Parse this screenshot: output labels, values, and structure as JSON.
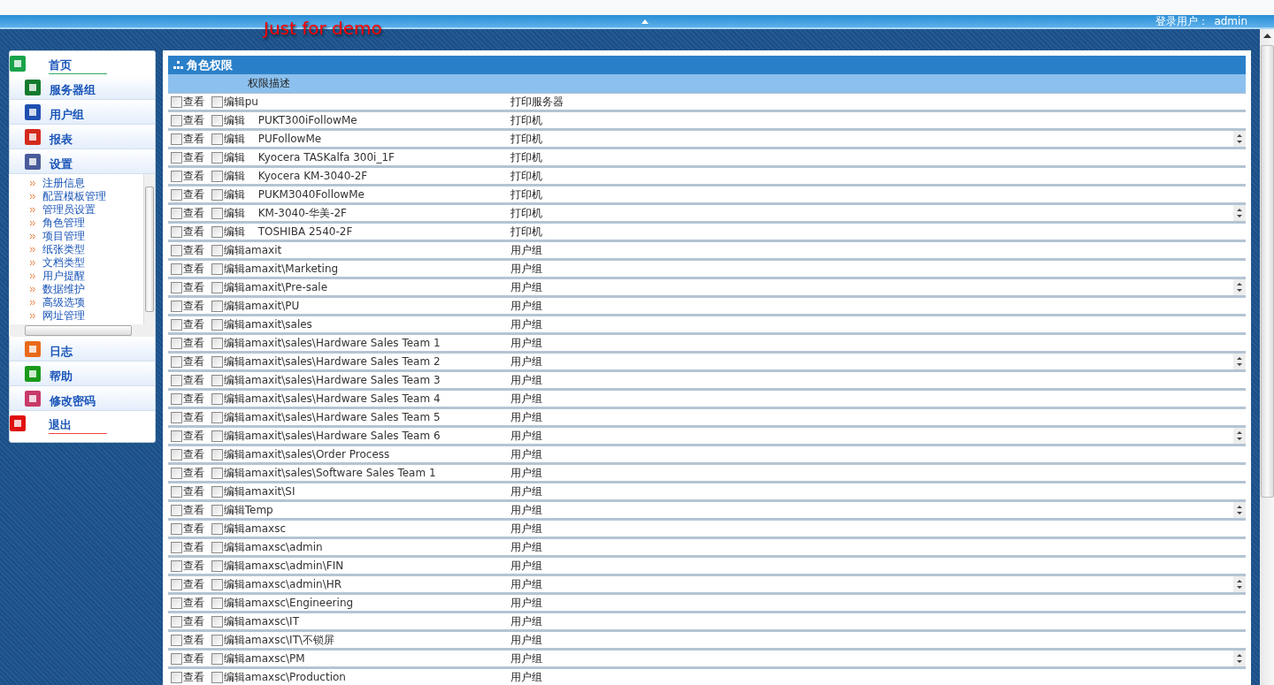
{
  "header": {
    "demo_text": "Just for demo",
    "login_label": "登录用户：",
    "login_user": "admin"
  },
  "sidebar": {
    "items": [
      {
        "label": "首页",
        "kind": "top"
      },
      {
        "label": "服务器组",
        "kind": "menu"
      },
      {
        "label": "用户组",
        "kind": "menu"
      },
      {
        "label": "报表",
        "kind": "menu"
      },
      {
        "label": "设置",
        "kind": "menu",
        "children": [
          "注册信息",
          "配置模板管理",
          "管理员设置",
          "角色管理",
          "项目管理",
          "纸张类型",
          "文档类型",
          "用户提醒",
          "数据维护",
          "高级选项",
          "网址管理"
        ]
      },
      {
        "label": "日志",
        "kind": "menu"
      },
      {
        "label": "帮助",
        "kind": "menu"
      },
      {
        "label": "修改密码",
        "kind": "menu"
      },
      {
        "label": "退出",
        "kind": "exit"
      }
    ]
  },
  "panel": {
    "title": "角色权限",
    "column_header": "权限描述",
    "rows": [
      {
        "view_label": "查看",
        "edit_label": "编辑",
        "name": "pu",
        "type": "打印服务器",
        "indented": false,
        "view_checked": false,
        "edit_checked": false,
        "scroll_arrows": false
      },
      {
        "view_label": "查看",
        "edit_label": "编辑",
        "name": "PUKT300iFollowMe",
        "type": "打印机",
        "indented": true,
        "view_checked": false,
        "edit_checked": false,
        "scroll_arrows": false
      },
      {
        "view_label": "查看",
        "edit_label": "编辑",
        "name": "PUFollowMe",
        "type": "打印机",
        "indented": true,
        "view_checked": false,
        "edit_checked": false,
        "scroll_arrows": true
      },
      {
        "view_label": "查看",
        "edit_label": "编辑",
        "name": "Kyocera TASKalfa 300i_1F",
        "type": "打印机",
        "indented": true,
        "view_checked": false,
        "edit_checked": false,
        "scroll_arrows": false
      },
      {
        "view_label": "查看",
        "edit_label": "编辑",
        "name": "Kyocera KM-3040-2F",
        "type": "打印机",
        "indented": true,
        "view_checked": false,
        "edit_checked": false,
        "scroll_arrows": false
      },
      {
        "view_label": "查看",
        "edit_label": "编辑",
        "name": "PUKM3040FollowMe",
        "type": "打印机",
        "indented": true,
        "view_checked": false,
        "edit_checked": false,
        "scroll_arrows": false
      },
      {
        "view_label": "查看",
        "edit_label": "编辑",
        "name": "KM-3040-华美-2F",
        "type": "打印机",
        "indented": true,
        "view_checked": false,
        "edit_checked": false,
        "scroll_arrows": true
      },
      {
        "view_label": "查看",
        "edit_label": "编辑",
        "name": "TOSHIBA 2540-2F",
        "type": "打印机",
        "indented": true,
        "view_checked": false,
        "edit_checked": false,
        "scroll_arrows": false
      },
      {
        "view_label": "查看",
        "edit_label": "编辑",
        "name": "amaxit",
        "type": "用户组",
        "indented": false,
        "view_checked": false,
        "edit_checked": false,
        "scroll_arrows": false
      },
      {
        "view_label": "查看",
        "edit_label": "编辑",
        "name": "amaxit\\Marketing",
        "type": "用户组",
        "indented": false,
        "view_checked": false,
        "edit_checked": false,
        "scroll_arrows": false
      },
      {
        "view_label": "查看",
        "edit_label": "编辑",
        "name": "amaxit\\Pre-sale",
        "type": "用户组",
        "indented": false,
        "view_checked": false,
        "edit_checked": false,
        "scroll_arrows": true
      },
      {
        "view_label": "查看",
        "edit_label": "编辑",
        "name": "amaxit\\PU",
        "type": "用户组",
        "indented": false,
        "view_checked": false,
        "edit_checked": false,
        "scroll_arrows": false
      },
      {
        "view_label": "查看",
        "edit_label": "编辑",
        "name": "amaxit\\sales",
        "type": "用户组",
        "indented": false,
        "view_checked": false,
        "edit_checked": false,
        "scroll_arrows": false
      },
      {
        "view_label": "查看",
        "edit_label": "编辑",
        "name": "amaxit\\sales\\Hardware Sales Team 1",
        "type": "用户组",
        "indented": false,
        "view_checked": false,
        "edit_checked": false,
        "scroll_arrows": false
      },
      {
        "view_label": "查看",
        "edit_label": "编辑",
        "name": "amaxit\\sales\\Hardware Sales Team 2",
        "type": "用户组",
        "indented": false,
        "view_checked": false,
        "edit_checked": false,
        "scroll_arrows": true
      },
      {
        "view_label": "查看",
        "edit_label": "编辑",
        "name": "amaxit\\sales\\Hardware Sales Team 3",
        "type": "用户组",
        "indented": false,
        "view_checked": false,
        "edit_checked": false,
        "scroll_arrows": false
      },
      {
        "view_label": "查看",
        "edit_label": "编辑",
        "name": "amaxit\\sales\\Hardware Sales Team 4",
        "type": "用户组",
        "indented": false,
        "view_checked": false,
        "edit_checked": false,
        "scroll_arrows": false
      },
      {
        "view_label": "查看",
        "edit_label": "编辑",
        "name": "amaxit\\sales\\Hardware Sales Team 5",
        "type": "用户组",
        "indented": false,
        "view_checked": false,
        "edit_checked": false,
        "scroll_arrows": false
      },
      {
        "view_label": "查看",
        "edit_label": "编辑",
        "name": "amaxit\\sales\\Hardware Sales Team 6",
        "type": "用户组",
        "indented": false,
        "view_checked": false,
        "edit_checked": false,
        "scroll_arrows": true
      },
      {
        "view_label": "查看",
        "edit_label": "编辑",
        "name": "amaxit\\sales\\Order Process",
        "type": "用户组",
        "indented": false,
        "view_checked": false,
        "edit_checked": false,
        "scroll_arrows": false
      },
      {
        "view_label": "查看",
        "edit_label": "编辑",
        "name": "amaxit\\sales\\Software Sales Team 1",
        "type": "用户组",
        "indented": false,
        "view_checked": false,
        "edit_checked": false,
        "scroll_arrows": false
      },
      {
        "view_label": "查看",
        "edit_label": "编辑",
        "name": "amaxit\\SI",
        "type": "用户组",
        "indented": false,
        "view_checked": false,
        "edit_checked": false,
        "scroll_arrows": false
      },
      {
        "view_label": "查看",
        "edit_label": "编辑",
        "name": "Temp",
        "type": "用户组",
        "indented": false,
        "view_checked": false,
        "edit_checked": false,
        "scroll_arrows": true
      },
      {
        "view_label": "查看",
        "edit_label": "编辑",
        "name": "amaxsc",
        "type": "用户组",
        "indented": false,
        "view_checked": false,
        "edit_checked": false,
        "scroll_arrows": false
      },
      {
        "view_label": "查看",
        "edit_label": "编辑",
        "name": "amaxsc\\admin",
        "type": "用户组",
        "indented": false,
        "view_checked": false,
        "edit_checked": false,
        "scroll_arrows": false
      },
      {
        "view_label": "查看",
        "edit_label": "编辑",
        "name": "amaxsc\\admin\\FIN",
        "type": "用户组",
        "indented": false,
        "view_checked": false,
        "edit_checked": false,
        "scroll_arrows": false
      },
      {
        "view_label": "查看",
        "edit_label": "编辑",
        "name": "amaxsc\\admin\\HR",
        "type": "用户组",
        "indented": false,
        "view_checked": false,
        "edit_checked": false,
        "scroll_arrows": true
      },
      {
        "view_label": "查看",
        "edit_label": "编辑",
        "name": "amaxsc\\Engineering",
        "type": "用户组",
        "indented": false,
        "view_checked": false,
        "edit_checked": false,
        "scroll_arrows": false
      },
      {
        "view_label": "查看",
        "edit_label": "编辑",
        "name": "amaxsc\\IT",
        "type": "用户组",
        "indented": false,
        "view_checked": false,
        "edit_checked": false,
        "scroll_arrows": false
      },
      {
        "view_label": "查看",
        "edit_label": "编辑",
        "name": "amaxsc\\IT\\不锁屏",
        "type": "用户组",
        "indented": false,
        "view_checked": false,
        "edit_checked": false,
        "scroll_arrows": false
      },
      {
        "view_label": "查看",
        "edit_label": "编辑",
        "name": "amaxsc\\PM",
        "type": "用户组",
        "indented": false,
        "view_checked": false,
        "edit_checked": false,
        "scroll_arrows": true
      },
      {
        "view_label": "查看",
        "edit_label": "编辑",
        "name": "amaxsc\\Production",
        "type": "用户组",
        "indented": false,
        "view_checked": false,
        "edit_checked": false,
        "scroll_arrows": false
      }
    ]
  }
}
